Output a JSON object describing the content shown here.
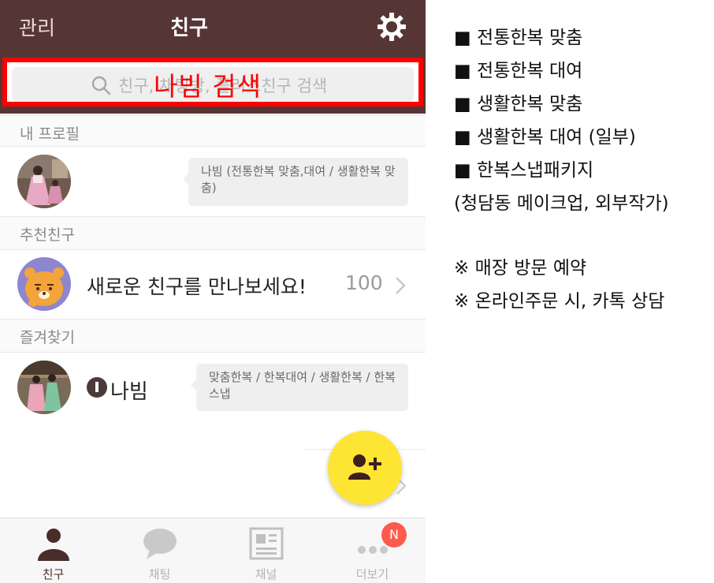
{
  "header": {
    "left_label": "관리",
    "title": "친구",
    "settings_icon": "gear-icon"
  },
  "search": {
    "placeholder": "친구, 채팅방, 플러스친구 검색",
    "overlay_label": "나빔 검색",
    "highlight_color": "#ff0000"
  },
  "sections": {
    "my_profile": "내 프로필",
    "recommended": "추천친구",
    "favorites": "즐겨찾기"
  },
  "my_profile": {
    "status": "나빔 (전통한복 맞춤,대여 / 생활한복 맞춤)"
  },
  "recommended": {
    "text": "새로운 친구를 만나보세요!",
    "count": "100"
  },
  "favorite": {
    "name": "나빔",
    "status": "맞춤한복 / 한복대여 / 생활한복 / 한복스냅"
  },
  "nav": {
    "items": [
      {
        "label": "친구",
        "icon": "person-icon",
        "active": true
      },
      {
        "label": "채팅",
        "icon": "chat-bubble-icon",
        "active": false
      },
      {
        "label": "채널",
        "icon": "channel-icon",
        "active": false
      },
      {
        "label": "더보기",
        "icon": "more-dots-icon",
        "active": false
      }
    ],
    "badge": "N"
  },
  "info": {
    "services": [
      "■ 전통한복 맞춤",
      "■ 전통한복 대여",
      "■ 생활한복 맞춤",
      "■ 생활한복 대여 (일부)",
      "■ 한복스냅패키지",
      "(청담동 메이크업, 외부작가)"
    ],
    "notes": [
      "※ 매장 방문 예약",
      "※ 온라인주문 시, 카톡 상담"
    ]
  },
  "colors": {
    "header_bg": "#563634",
    "fab": "#ffe533",
    "badge": "#ff5a4e"
  }
}
